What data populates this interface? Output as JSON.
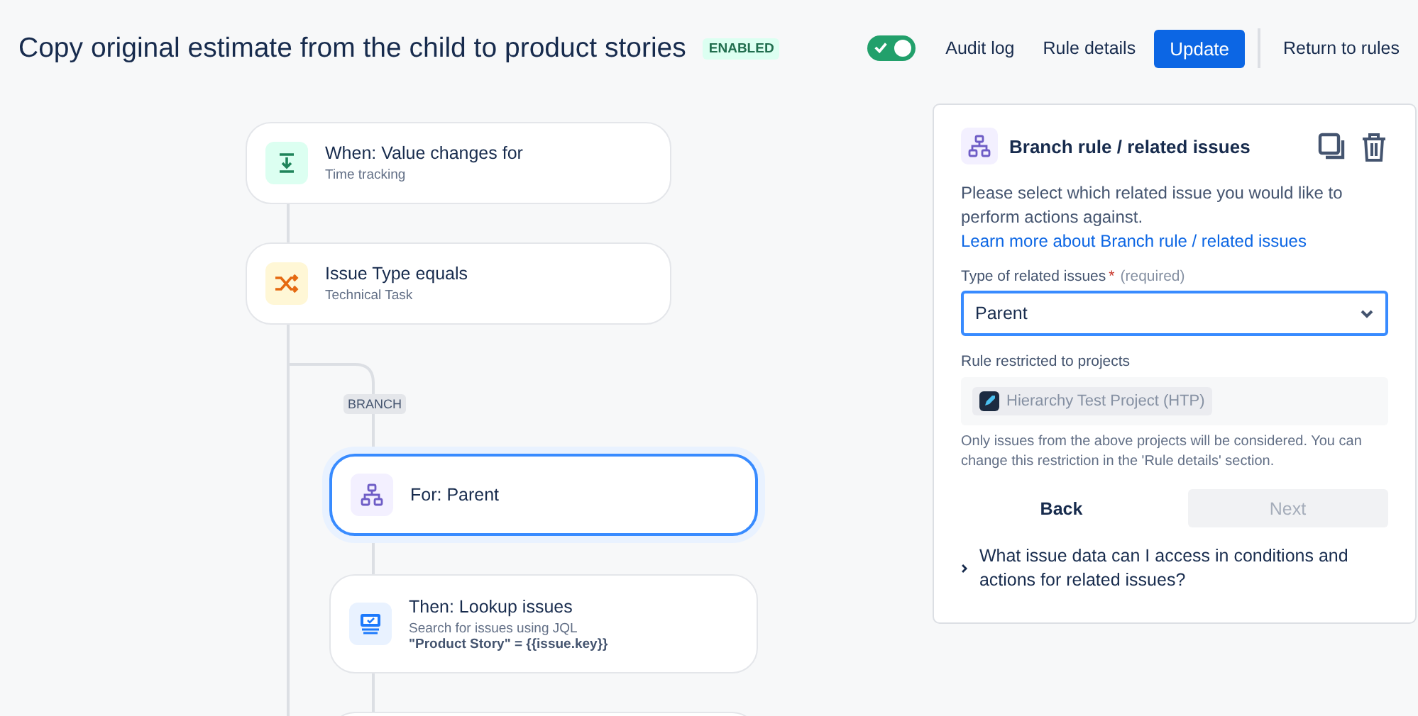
{
  "header": {
    "title": "Copy original estimate from the child to product stories",
    "status_badge": "ENABLED",
    "rule_toggle": {
      "on": true
    },
    "actions": [
      {
        "label": "Audit log",
        "kind": "link"
      },
      {
        "label": "Rule details",
        "kind": "link"
      },
      {
        "label": "Update",
        "kind": "primary"
      }
    ],
    "return_link": "Return to rules"
  },
  "flow": {
    "nodes": [
      {
        "kind": "trigger",
        "title": "When: Value changes for",
        "subtitle": "Time tracking",
        "selected": false
      },
      {
        "kind": "condition",
        "title": "Issue Type equals",
        "subtitle": "Technical Task",
        "selected": false
      },
      {
        "kind": "branch",
        "title": "For: Parent",
        "selected": true
      },
      {
        "kind": "action",
        "title": "Then: Lookup issues",
        "subtitle": "Search for issues using JQL",
        "detail": "\"Product Story\" = {{issue.key}}",
        "selected": false
      }
    ],
    "branch_label": "BRANCH"
  },
  "panel": {
    "title": "Branch rule / related issues",
    "description": "Please select which related issue you would like to perform actions against.",
    "learn_more_link": "Learn more about Branch rule / related issues",
    "type_field": {
      "label": "Type of related issues",
      "required_mark": "*",
      "required_hint": "(required)",
      "value": "Parent"
    },
    "projects": {
      "label": "Rule restricted to projects",
      "project": "Hierarchy Test Project (HTP)",
      "help": "Only issues from the above projects will be considered. You can change this restriction in the 'Rule details' section."
    },
    "buttons": [
      {
        "label": "Back",
        "disabled": false
      },
      {
        "label": "Next",
        "disabled": true
      }
    ],
    "faq": {
      "label": "What issue data can I access in conditions and actions for related issues?",
      "expanded": false
    }
  }
}
